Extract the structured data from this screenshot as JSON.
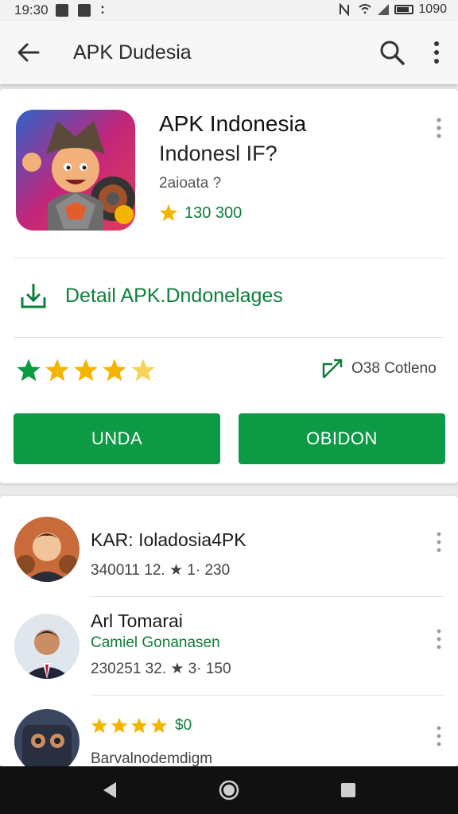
{
  "status_bar": {
    "time": "19:30",
    "right_text": "1090"
  },
  "app_bar": {
    "title": "APK Dudesia",
    "back_icon": "arrow-left-icon",
    "search_icon": "search-icon",
    "more_icon": "more-vert-icon"
  },
  "app_card": {
    "name": "APK Indonesia",
    "developer": "Indonesl IF?",
    "meta": "2aioata  ?",
    "rating_text": "130 300",
    "detail_label": "Detail APK.Dndonelages",
    "stars": 4.5,
    "condition_label": "O38 Cotleno",
    "button_left": "UNDA",
    "button_right": "OBIDON",
    "colors": {
      "accent": "#0c9a45",
      "accent_text": "#0d7f38",
      "star": "#f4b400"
    }
  },
  "list": {
    "items": [
      {
        "title": "KAR: Ioladosia4PK",
        "meta": "340011 12. ★ 1· 230"
      },
      {
        "title": "Arl Tomarai",
        "subtitle": "Camiel Gonanasen",
        "meta": "230251 32. ★ 3· 150"
      },
      {
        "rating_value": "$0",
        "title": "Barvalnodemdigm"
      }
    ]
  },
  "nav_bar": {
    "back": "nav-back-icon",
    "home": "nav-home-icon",
    "recents": "nav-recents-icon"
  }
}
